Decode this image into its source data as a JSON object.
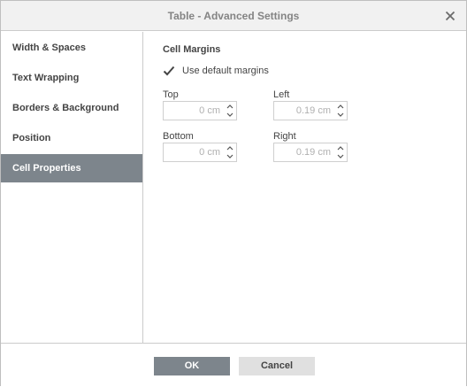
{
  "dialog": {
    "title": "Table - Advanced Settings"
  },
  "sidebar": {
    "items": [
      {
        "label": "Width & Spaces",
        "active": false
      },
      {
        "label": "Text Wrapping",
        "active": false
      },
      {
        "label": "Borders & Background",
        "active": false
      },
      {
        "label": "Position",
        "active": false
      },
      {
        "label": "Cell Properties",
        "active": true
      }
    ]
  },
  "cell_margins": {
    "title": "Cell Margins",
    "use_default": {
      "label": "Use default margins",
      "checked": true
    },
    "top": {
      "label": "Top",
      "value": "0 cm"
    },
    "left": {
      "label": "Left",
      "value": "0.19 cm"
    },
    "bottom": {
      "label": "Bottom",
      "value": "0 cm"
    },
    "right": {
      "label": "Right",
      "value": "0.19 cm"
    }
  },
  "footer": {
    "ok_label": "OK",
    "cancel_label": "Cancel"
  },
  "colors": {
    "active_item": "#7d858c",
    "primary_button": "#7d858c",
    "secondary_button": "#e0e0e0",
    "disabled_text": "#b0b0b0"
  },
  "icons": {
    "close": "close-icon",
    "check": "checkmark-icon",
    "spin_up": "chevron-up-icon",
    "spin_down": "chevron-down-icon"
  }
}
